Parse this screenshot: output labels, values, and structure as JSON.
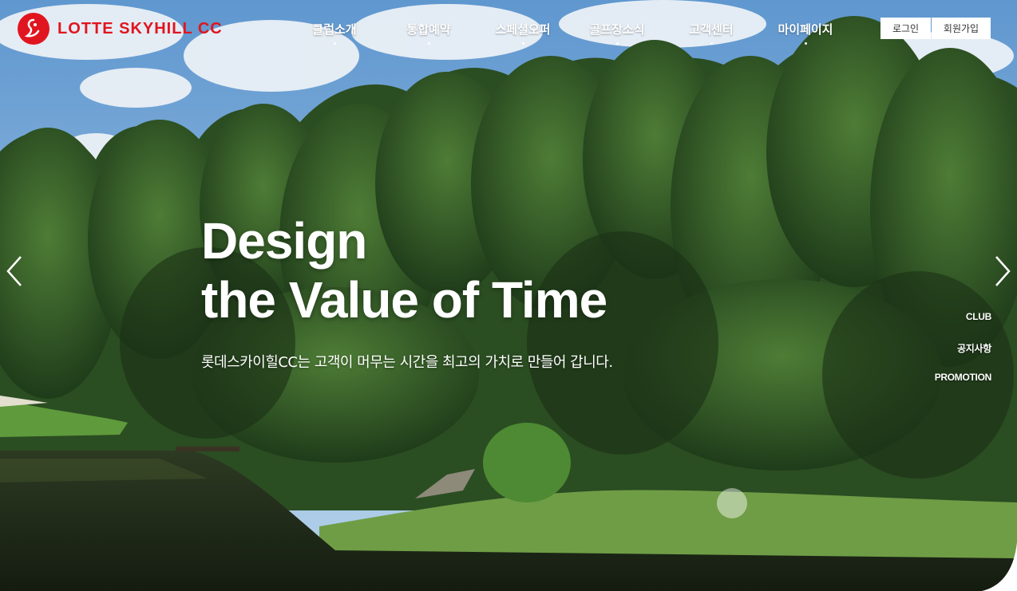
{
  "header": {
    "logo_text": "LOTTE SKYHILL CC",
    "nav": [
      "클럽소개",
      "통합예약",
      "스페셜오퍼",
      "골프장소식",
      "고객센터",
      "마이페이지"
    ],
    "login_label": "로그인",
    "signup_label": "회원가입"
  },
  "hero": {
    "headline_line1": "Design",
    "headline_line2": "the Value of Time",
    "subcopy": "롯데스카이힐CC는 고객이 머무는 시간을 최고의 가치로 만들어 갑니다."
  },
  "side_nav": [
    "CLUB",
    "공지사항",
    "PROMOTION"
  ],
  "icons": {
    "prev": "chevron-left-icon",
    "next": "chevron-right-icon"
  },
  "colors": {
    "brand_red": "#e1151f",
    "sky": "#6fa6d6",
    "forest": "#2f5a2a"
  }
}
